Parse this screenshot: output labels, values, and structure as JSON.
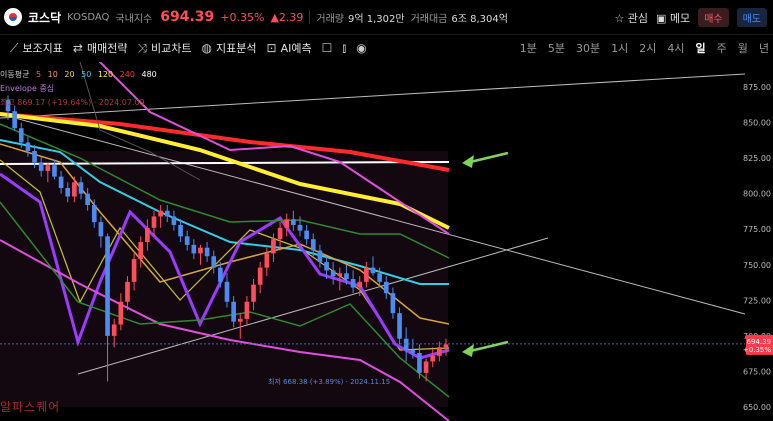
{
  "header": {
    "name": "코스닥",
    "market": "KOSDAQ",
    "index_type": "국내지수",
    "price": "694.39",
    "change_pct": "+0.35%",
    "change_amt": "▲2.39",
    "volume_label": "거래량",
    "volume_value": "9억 1,302만",
    "amount_label": "거래대금",
    "amount_value": "6조 8,304억",
    "interest_label": "관심",
    "memo_label": "메모",
    "buy_label": "매수",
    "sell_label": "매도"
  },
  "toolbar": {
    "tools": [
      "보조지표",
      "매매전략",
      "비교차트",
      "지표분석",
      "AI예측"
    ],
    "periods": [
      "1분",
      "5분",
      "30분",
      "1시",
      "2시",
      "4시",
      "일",
      "주",
      "월",
      "년"
    ],
    "active_period": "일"
  },
  "legend": {
    "ma_label": "이동평균",
    "ma_periods": [
      "5",
      "10",
      "20",
      "50",
      "120",
      "240",
      "480"
    ],
    "envelope_label": "Envelope 중심",
    "high_label": "최고 869.17 (+19.64%) · 2024.07.09"
  },
  "annotations": {
    "low_label": "최저 668.38 (+3.89%) · 2024.11.15"
  },
  "price_axis": {
    "ticks": [
      "875.00",
      "850.00",
      "825.00",
      "800.00",
      "775.00",
      "750.00",
      "725.00",
      "700.00",
      "675.00",
      "650.00"
    ],
    "current_price": "694.39",
    "current_change": "+0.35%"
  },
  "watermark": "알파스퀘어",
  "colors": {
    "up": "#ff4d5a",
    "down": "#4c8bf0",
    "bg": "#000000",
    "arrow": "#7fd35a"
  },
  "chart_data": {
    "type": "candlestick",
    "y_range": [
      650,
      875
    ],
    "candles": [
      [
        866,
        869,
        852,
        858
      ],
      [
        858,
        862,
        844,
        846
      ],
      [
        846,
        850,
        832,
        836
      ],
      [
        836,
        840,
        826,
        830
      ],
      [
        830,
        834,
        818,
        822
      ],
      [
        822,
        826,
        812,
        816
      ],
      [
        816,
        822,
        808,
        820
      ],
      [
        820,
        824,
        810,
        812
      ],
      [
        812,
        816,
        800,
        804
      ],
      [
        804,
        808,
        794,
        798
      ],
      [
        798,
        812,
        794,
        808
      ],
      [
        808,
        812,
        796,
        800
      ],
      [
        800,
        804,
        788,
        792
      ],
      [
        792,
        796,
        776,
        780
      ],
      [
        780,
        784,
        762,
        770
      ],
      [
        770,
        772,
        668,
        700
      ],
      [
        700,
        712,
        692,
        708
      ],
      [
        708,
        730,
        704,
        724
      ],
      [
        724,
        742,
        718,
        738
      ],
      [
        738,
        758,
        732,
        754
      ],
      [
        754,
        770,
        748,
        766
      ],
      [
        766,
        782,
        760,
        776
      ],
      [
        776,
        788,
        770,
        784
      ],
      [
        784,
        792,
        776,
        788
      ],
      [
        788,
        792,
        780,
        784
      ],
      [
        784,
        788,
        774,
        778
      ],
      [
        778,
        782,
        766,
        770
      ],
      [
        770,
        774,
        760,
        764
      ],
      [
        764,
        768,
        754,
        758
      ],
      [
        758,
        764,
        750,
        762
      ],
      [
        762,
        766,
        752,
        756
      ],
      [
        756,
        760,
        744,
        748
      ],
      [
        748,
        752,
        734,
        738
      ],
      [
        738,
        744,
        720,
        724
      ],
      [
        724,
        728,
        706,
        710
      ],
      [
        710,
        716,
        698,
        712
      ],
      [
        712,
        728,
        708,
        724
      ],
      [
        724,
        740,
        718,
        736
      ],
      [
        736,
        752,
        730,
        748
      ],
      [
        748,
        762,
        742,
        758
      ],
      [
        758,
        772,
        752,
        768
      ],
      [
        768,
        780,
        760,
        776
      ],
      [
        776,
        786,
        770,
        782
      ],
      [
        782,
        788,
        774,
        778
      ],
      [
        778,
        784,
        770,
        774
      ],
      [
        774,
        778,
        764,
        768
      ],
      [
        768,
        772,
        756,
        760
      ],
      [
        760,
        764,
        748,
        752
      ],
      [
        752,
        756,
        740,
        746
      ],
      [
        746,
        752,
        736,
        742
      ],
      [
        742,
        748,
        732,
        744
      ],
      [
        744,
        750,
        736,
        740
      ],
      [
        740,
        746,
        730,
        734
      ],
      [
        734,
        742,
        728,
        738
      ],
      [
        738,
        752,
        734,
        748
      ],
      [
        748,
        756,
        742,
        744
      ],
      [
        744,
        748,
        734,
        738
      ],
      [
        738,
        742,
        726,
        730
      ],
      [
        730,
        734,
        712,
        716
      ],
      [
        716,
        720,
        694,
        698
      ],
      [
        698,
        706,
        682,
        690
      ],
      [
        690,
        698,
        684,
        688
      ],
      [
        688,
        694,
        670,
        674
      ],
      [
        674,
        684,
        668,
        682
      ],
      [
        682,
        692,
        678,
        686
      ],
      [
        686,
        696,
        682,
        692
      ],
      [
        692,
        698,
        686,
        694
      ]
    ]
  }
}
